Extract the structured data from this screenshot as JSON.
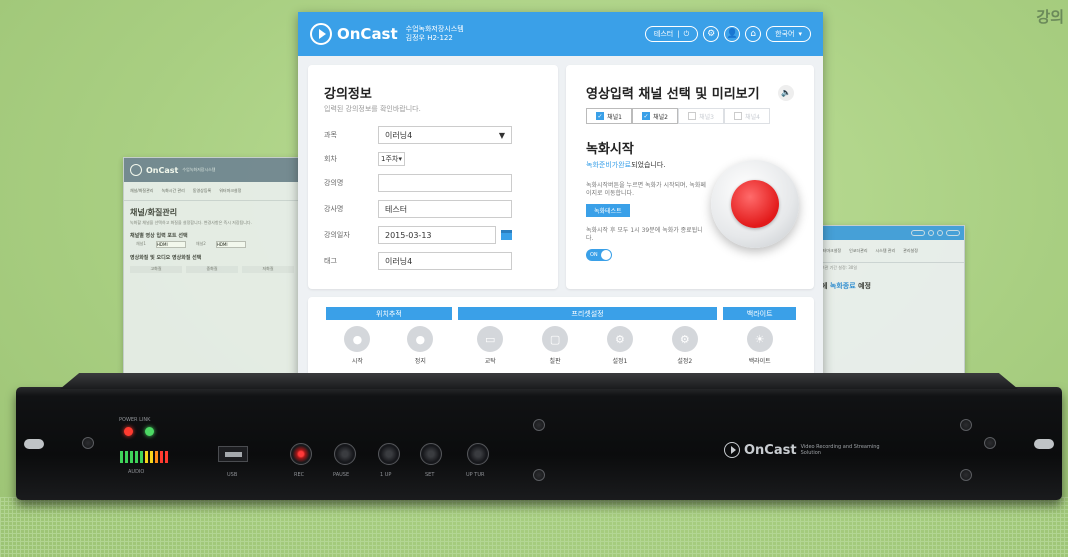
{
  "corner_title": "강의",
  "back_left": {
    "brand": "OnCast",
    "subtitle": "수업녹화저장시스템",
    "tabs": [
      "채널/화질관리",
      "녹화시간 관리",
      "동영상등록",
      "워터마크설정"
    ],
    "title": "채널/화질관리",
    "desc": "녹화할 채널을 선택하고 화질을 설정합니다. 변경사항은 즉시 저장됩니다.",
    "section1": "채널별 영상 입력 포트 선택",
    "port1": "채널1",
    "port1_val": "HDMI",
    "port2": "채널2",
    "port2_val": "HDMI",
    "section2": "영상화질 및 오디오 영상화질 선택",
    "cols": [
      "고화질",
      "중화질",
      "저화질"
    ]
  },
  "back_right": {
    "tabs": [
      "워터마크설정",
      "인코더관리",
      "시스템 관리",
      "관리설정"
    ],
    "line1": "보관 기간 설정: 30일",
    "big_prefix": "에",
    "big_blue": "녹화종료",
    "big_suffix": "예정"
  },
  "main": {
    "brand": "OnCast",
    "system_name": "수업녹화저장시스템",
    "room": "김정우 H2-122",
    "user_pill": "테스터",
    "lang_pill": "한국어",
    "info": {
      "title": "강의정보",
      "subtitle": "입력된 강의정보를 확인바랍니다.",
      "fields": [
        {
          "label": "과목",
          "value": "이러닝4"
        },
        {
          "label": "회차",
          "value": "1주차"
        },
        {
          "label": "강의명",
          "value": ""
        },
        {
          "label": "강사명",
          "value": "테스터"
        },
        {
          "label": "강의일자",
          "value": "2015-03-13"
        },
        {
          "label": "태그",
          "value": "이러닝4"
        }
      ]
    },
    "channel": {
      "title": "영상입력 채널 선택 및 미리보기",
      "channels": [
        {
          "label": "채널1",
          "checked": true
        },
        {
          "label": "채널2",
          "checked": true
        },
        {
          "label": "채널3",
          "checked": false
        },
        {
          "label": "채널4",
          "checked": false
        }
      ],
      "rec_title": "녹화시작",
      "rec_state_blue": "녹화준비가완료",
      "rec_state_rest": "되었습니다.",
      "note1": "녹화시작버튼을 누르면 녹화가 시작되며, 녹화페이지로 이동합니다.",
      "test_btn": "녹화테스트",
      "note2": "녹화시작 후 모두 1시 39분에 녹화가 종료됩니다.",
      "toggle": "ON"
    },
    "controls": {
      "groups": [
        {
          "header": "위치추적",
          "items": [
            "시작",
            "정지"
          ]
        },
        {
          "header": "프리셋설정",
          "items": [
            "교탁",
            "칠판",
            "설정1",
            "설정2"
          ]
        },
        {
          "header": "백라이트",
          "items": [
            "백라이트"
          ]
        }
      ]
    }
  },
  "device": {
    "power_label": "POWER LINK",
    "level_label": "AUDIO",
    "usb_label": "USB",
    "buttons": [
      "REC",
      "PAUSE",
      "1 UP",
      "SET",
      "UP TUR"
    ],
    "brand": "OnCast",
    "tagline": "Video Recording and Streaming Solution"
  }
}
